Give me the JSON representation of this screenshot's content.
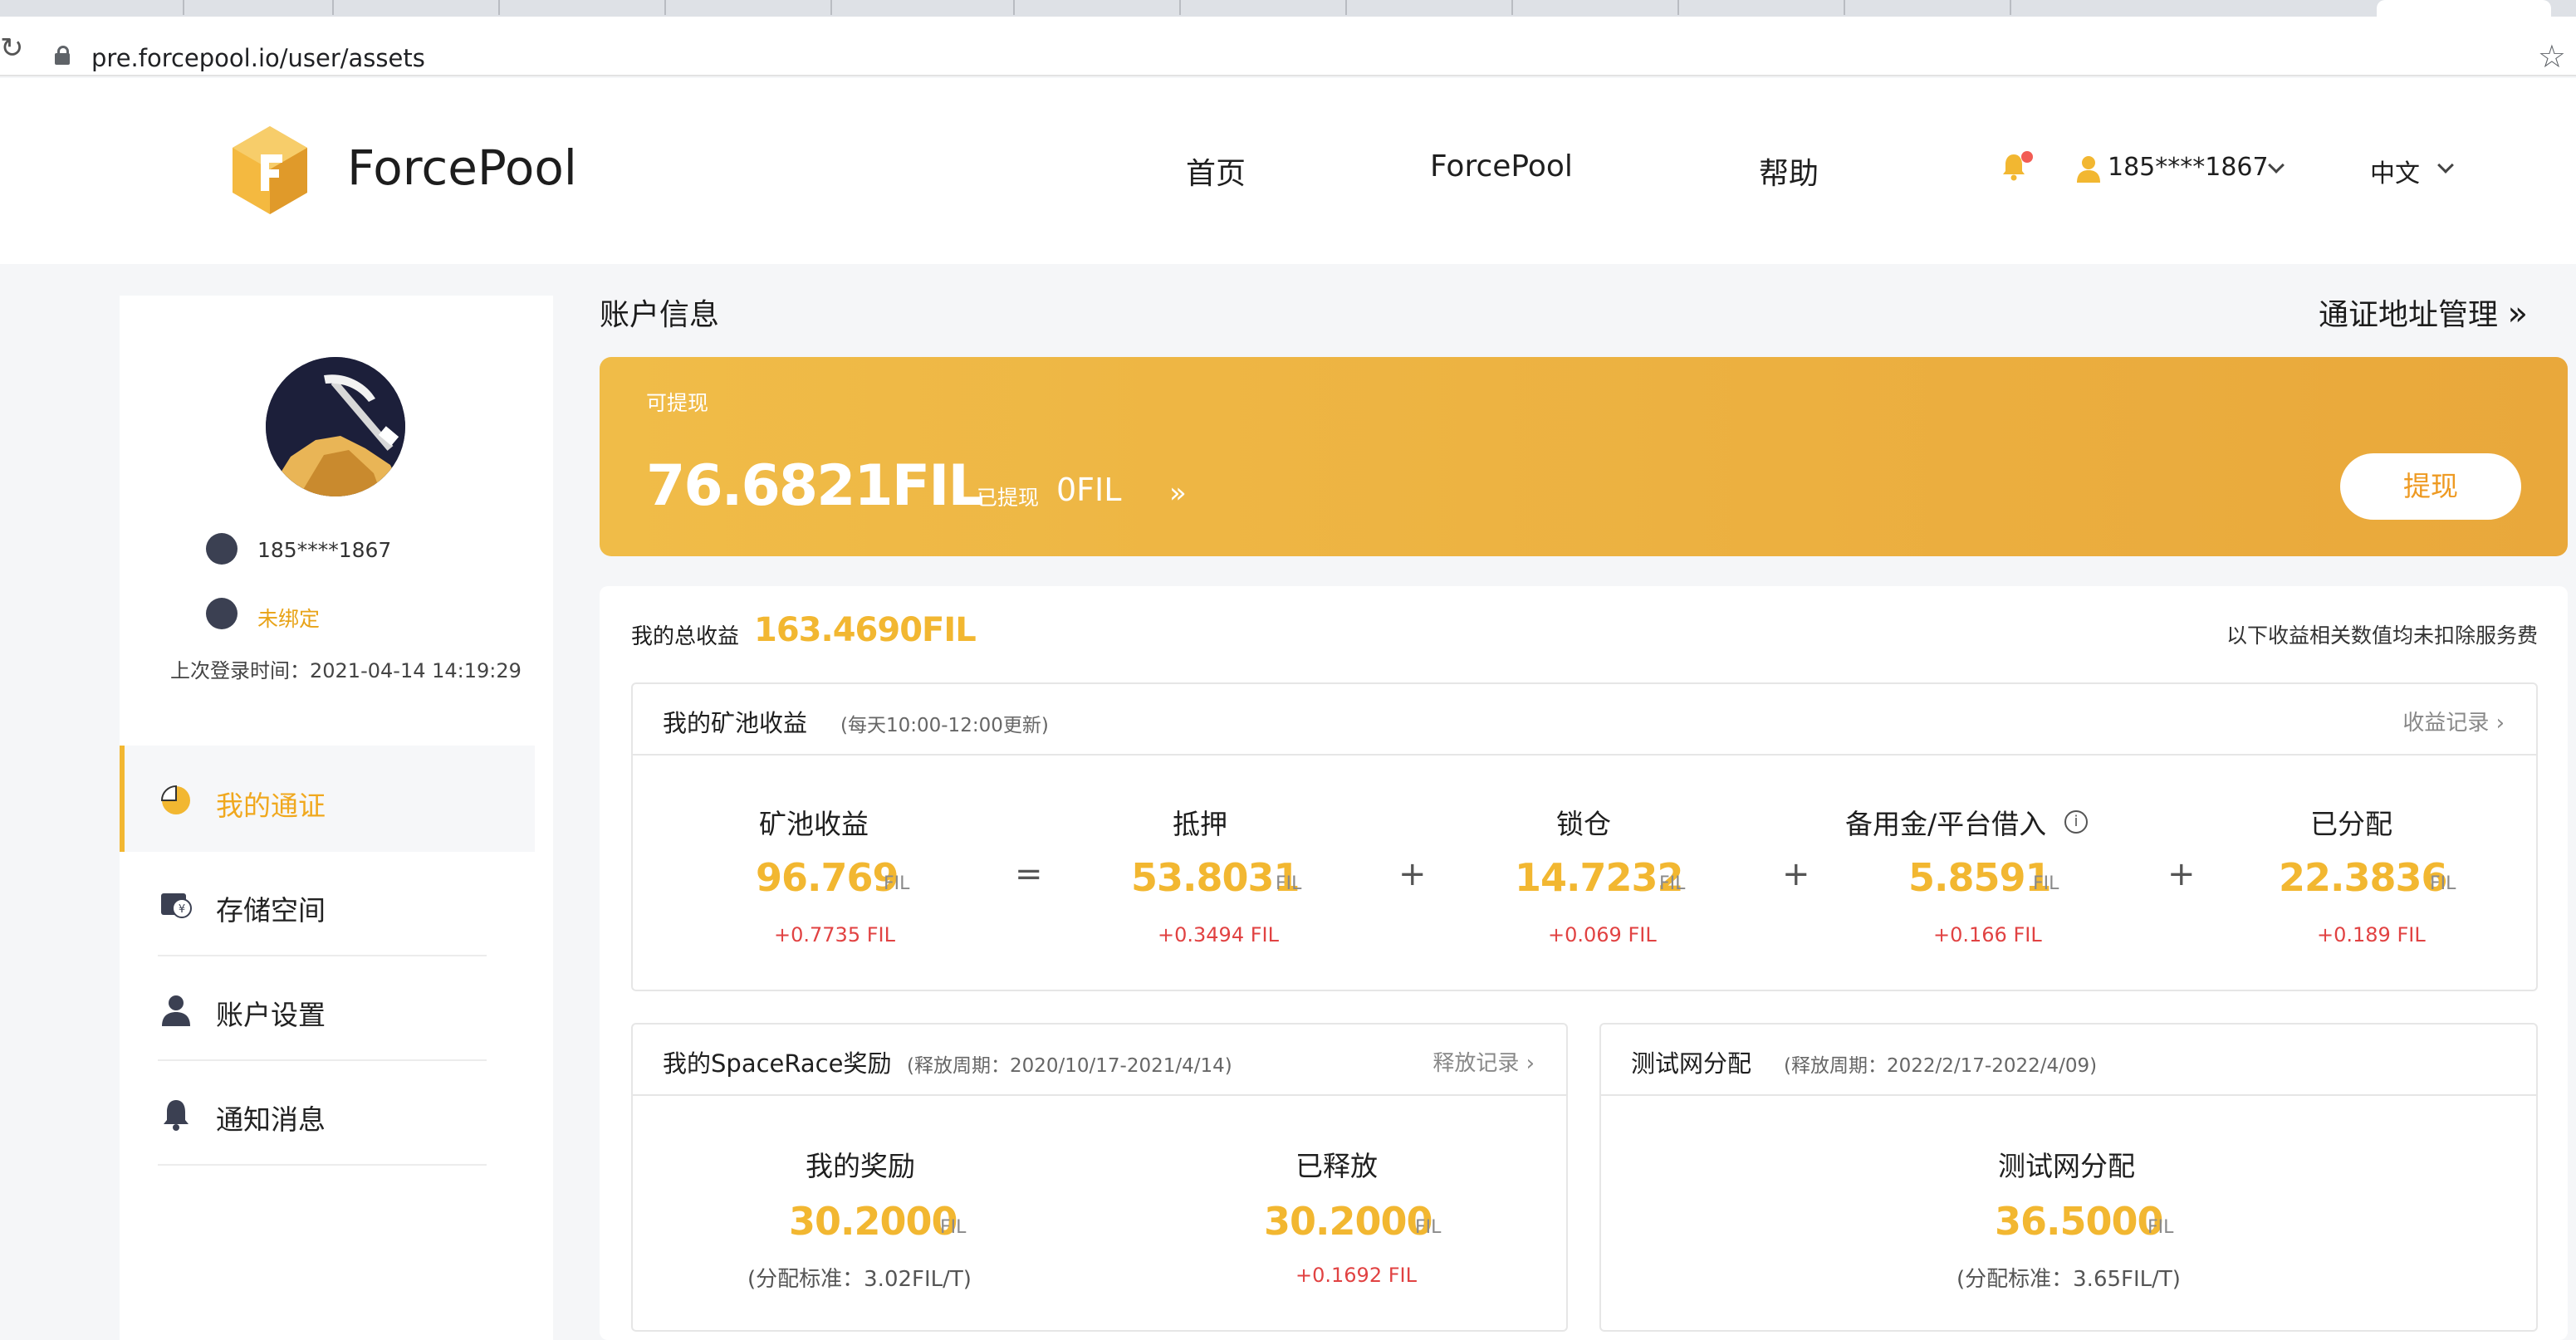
{
  "browser": {
    "url": "pre.forcepool.io/user/assets"
  },
  "header": {
    "brand": "ForcePool",
    "nav": [
      "首页",
      "ForcePool",
      "帮助"
    ],
    "user_phone": "185****1867",
    "language": "中文"
  },
  "sidebar": {
    "phone": "185****1867",
    "email_status": "未绑定",
    "last_login_label": "上次登录时间：",
    "last_login_time": "2021-04-14 14:19:29",
    "menu": [
      {
        "label": "我的通证",
        "active": true
      },
      {
        "label": "存储空间",
        "active": false
      },
      {
        "label": "账户设置",
        "active": false
      },
      {
        "label": "通知消息",
        "active": false
      }
    ]
  },
  "account": {
    "title": "账户信息",
    "address_manage": "通证地址管理",
    "withdrawable_label": "可提现",
    "withdrawable_amount": "76.6821FIL",
    "withdrawn_label": "已提现",
    "withdrawn_amount": "0FIL",
    "withdraw_button": "提现"
  },
  "earnings": {
    "total_label": "我的总收益",
    "total_value": "163.4690FIL",
    "note": "以下收益相关数值均未扣除服务费",
    "pool": {
      "title": "我的矿池收益",
      "subtitle": "(每天10:00-12:00更新)",
      "link": "收益记录",
      "operators": [
        "=",
        "+",
        "+",
        "+"
      ],
      "columns": [
        {
          "label": "矿池收益",
          "value": "96.769",
          "unit": "FIL",
          "delta": "+0.7735",
          "delta_unit": "FIL"
        },
        {
          "label": "抵押",
          "value": "53.8031",
          "unit": "FIL",
          "delta": "+0.3494",
          "delta_unit": "FIL"
        },
        {
          "label": "锁仓",
          "value": "14.7232",
          "unit": "FIL",
          "delta": "+0.069",
          "delta_unit": "FIL"
        },
        {
          "label": "备用金/平台借入",
          "value": "5.8591",
          "unit": "FIL",
          "delta": "+0.166",
          "delta_unit": "FIL"
        },
        {
          "label": "已分配",
          "value": "22.3836",
          "unit": "FIL",
          "delta": "+0.189",
          "delta_unit": "FIL"
        }
      ]
    },
    "spacerace": {
      "title": "我的SpaceRace奖励",
      "subtitle": "(释放周期：2020/10/17-2021/4/14)",
      "link": "释放记录",
      "reward_label": "我的奖励",
      "reward_value": "30.2000",
      "reward_unit": "FIL",
      "reward_note": "(分配标准：3.02FIL/T)",
      "released_label": "已释放",
      "released_value": "30.2000",
      "released_unit": "FIL",
      "released_delta": "+0.1692",
      "released_delta_unit": "FIL"
    },
    "testnet": {
      "title": "测试网分配",
      "subtitle": "(释放周期：2022/2/17-2022/4/09)",
      "label": "测试网分配",
      "value": "36.5000",
      "unit": "FIL",
      "note": "(分配标准：3.65FIL/T)"
    }
  },
  "colors": {
    "accent": "#f2b731",
    "banner_start": "#f0bc48",
    "banner_end": "#e9a83b",
    "delta_red": "#e14242"
  }
}
